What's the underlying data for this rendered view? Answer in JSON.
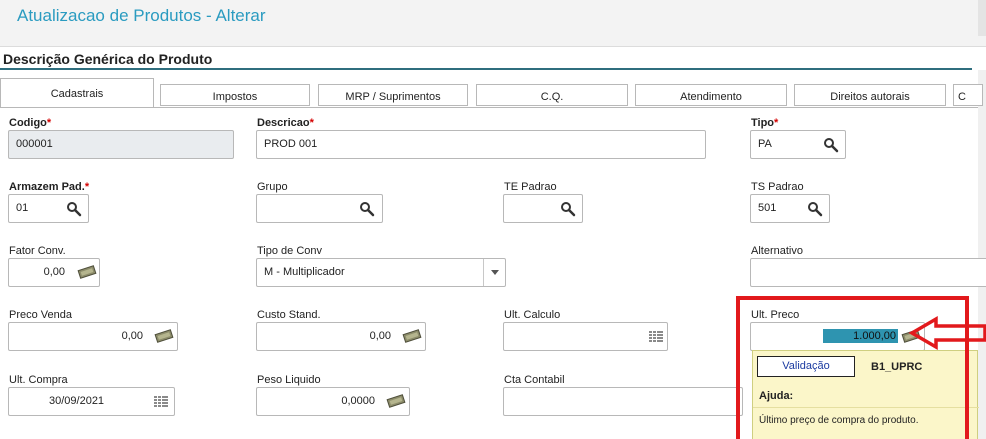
{
  "window": {
    "title": "Atualizacao de Produtos - Alterar"
  },
  "section_title": "Descrição Genérica do Produto",
  "tabs": [
    {
      "label": "Cadastrais",
      "active": true
    },
    {
      "label": "Impostos"
    },
    {
      "label": "MRP / Suprimentos"
    },
    {
      "label": "C.Q."
    },
    {
      "label": "Atendimento"
    },
    {
      "label": "Direitos autorais"
    },
    {
      "label": "C"
    }
  ],
  "required_mark": "*",
  "fields": {
    "codigo": {
      "label": "Codigo",
      "value": "000001"
    },
    "descricao": {
      "label": "Descricao",
      "value": "PROD 001"
    },
    "tipo": {
      "label": "Tipo",
      "value": "PA"
    },
    "armazem": {
      "label": "Armazem Pad.",
      "value": "01"
    },
    "grupo": {
      "label": "Grupo",
      "value": ""
    },
    "te_padrao": {
      "label": "TE Padrao",
      "value": ""
    },
    "ts_padrao": {
      "label": "TS Padrao",
      "value": "501"
    },
    "fator_conv": {
      "label": "Fator Conv.",
      "value": "0,00"
    },
    "tipo_conv": {
      "label": "Tipo de Conv",
      "value": "M - Multiplicador"
    },
    "alternativo": {
      "label": "Alternativo",
      "value": ""
    },
    "preco_venda": {
      "label": "Preco Venda",
      "value": "0,00"
    },
    "custo_stand": {
      "label": "Custo Stand.",
      "value": "0,00"
    },
    "ult_calculo": {
      "label": "Ult. Calculo",
      "value": "  /  /"
    },
    "ult_preco": {
      "label": "Ult. Preco",
      "value": "1.000,00"
    },
    "ult_compra": {
      "label": "Ult. Compra",
      "value": "30/09/2021"
    },
    "peso_liquido": {
      "label": "Peso Liquido",
      "value": "0,0000"
    },
    "cta_contabil": {
      "label": "Cta Contabil",
      "value": ""
    }
  },
  "help_popup": {
    "validation_button": "Validação",
    "field_code": "B1_UPRC",
    "help_label": "Ajuda:",
    "description": "Último preço de compra do produto."
  },
  "icons": {
    "lookup": "magnifier-icon",
    "money": "money-icon",
    "calendar": "calendar-icon",
    "dropdown": "chevron-down-icon"
  },
  "colors": {
    "title": "#2a9bc0",
    "required": "#d40000",
    "highlight": "#2e94b0",
    "annotation": "#e2191c",
    "help_bg": "#fbf6c9"
  }
}
